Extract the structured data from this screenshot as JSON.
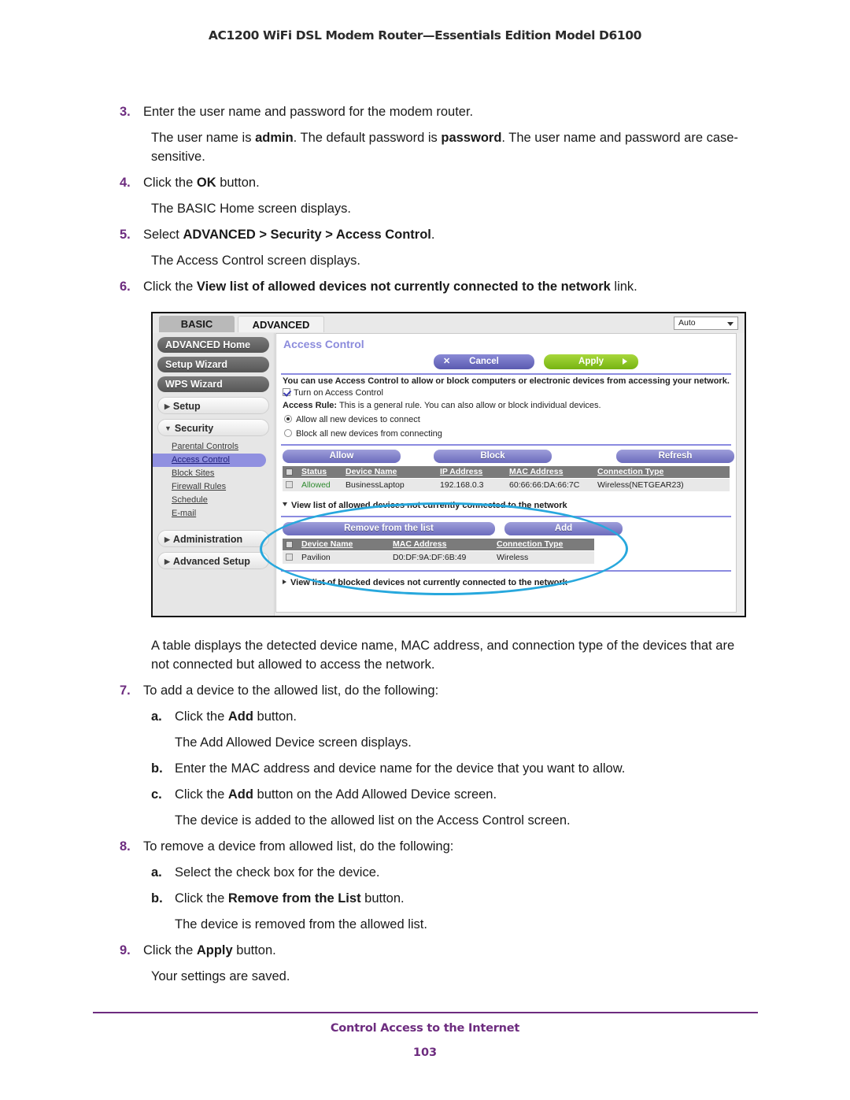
{
  "header": {
    "running_title": "AC1200 WiFi DSL Modem Router—Essentials Edition Model D6100"
  },
  "footer": {
    "section_title": "Control Access to the Internet",
    "page_number": "103"
  },
  "steps": {
    "s3_num": "3.",
    "s3_text": "Enter the user name and password for the modem router.",
    "s3_para_a": "The user name is ",
    "s3_para_admin": "admin",
    "s3_para_b": ". The default password is ",
    "s3_para_password": "password",
    "s3_para_c": ". The user name and password are case-sensitive.",
    "s4_num": "4.",
    "s4_text_a": "Click the ",
    "s4_bold": "OK",
    "s4_text_b": " button.",
    "s4_para": "The BASIC Home screen displays.",
    "s5_num": "5.",
    "s5_text_a": "Select ",
    "s5_bold": "ADVANCED > Security > Access Control",
    "s5_text_b": ".",
    "s5_para": "The Access Control screen displays.",
    "s6_num": "6.",
    "s6_text_a": "Click the ",
    "s6_bold": "View list of allowed devices not currently connected to the network",
    "s6_text_b": " link.",
    "after_shot_para": "A table displays the detected device name, MAC address, and connection type of the devices that are not connected but allowed to access the network.",
    "s7_num": "7.",
    "s7_text": "To add a device to the allowed list, do the following:",
    "s7a_num": "a.",
    "s7a_text_a": "Click the ",
    "s7a_bold": "Add",
    "s7a_text_b": " button.",
    "s7a_para": "The Add Allowed Device screen displays.",
    "s7b_num": "b.",
    "s7b_text": "Enter the MAC address and device name for the device that you want to allow.",
    "s7c_num": "c.",
    "s7c_text_a": "Click the ",
    "s7c_bold": "Add",
    "s7c_text_b": " button on the Add Allowed Device screen.",
    "s7c_para": "The device is added to the allowed list on the Access Control screen.",
    "s8_num": "8.",
    "s8_text": "To remove a device from allowed list, do the following:",
    "s8a_num": "a.",
    "s8a_text": "Select the check box for the device.",
    "s8b_num": "b.",
    "s8b_text_a": "Click the ",
    "s8b_bold": "Remove from the List",
    "s8b_text_b": " button.",
    "s8b_para": "The device is removed from the allowed list.",
    "s9_num": "9.",
    "s9_text_a": "Click the ",
    "s9_bold": "Apply",
    "s9_text_b": " button.",
    "s9_para": "Your settings are saved."
  },
  "screenshot": {
    "tabs": {
      "basic": "BASIC",
      "advanced": "ADVANCED"
    },
    "language_select": {
      "value": "Auto"
    },
    "sidebar": {
      "buttons": [
        "ADVANCED Home",
        "Setup Wizard",
        "WPS Wizard"
      ],
      "sections": [
        {
          "label": "Setup",
          "expanded": false
        },
        {
          "label": "Security",
          "expanded": true
        }
      ],
      "security_items": [
        "Parental Controls",
        "Access Control",
        "Block Sites",
        "Firewall Rules",
        "Schedule",
        "E-mail"
      ],
      "selected_item": "Access Control",
      "bottom_sections": [
        "Administration",
        "Advanced Setup"
      ]
    },
    "pane": {
      "title": "Access Control",
      "cancel_label": "Cancel",
      "apply_label": "Apply",
      "description": "You can use Access Control to allow or block computers or electronic devices from accessing your network.",
      "turn_on_label": "Turn on Access Control",
      "turn_on_checked": true,
      "access_rule_label": "Access Rule:",
      "access_rule_text": " This is a general rule. You can also allow or block individual devices.",
      "radio_allow": "Allow all new devices to connect",
      "radio_block": "Block all new devices from connecting",
      "radio_selected": "allow",
      "buttons": {
        "allow": "Allow",
        "block": "Block",
        "refresh": "Refresh",
        "remove_from_list": "Remove from the list",
        "add": "Add"
      },
      "connected_table": {
        "headers": [
          "Status",
          "Device Name",
          "IP Address",
          "MAC Address",
          "Connection Type"
        ],
        "rows": [
          {
            "status": "Allowed",
            "device_name": "BusinessLaptop",
            "ip_address": "192.168.0.3",
            "mac_address": "60:66:66:DA:66:7C",
            "connection_type": "Wireless(NETGEAR23)"
          }
        ]
      },
      "allowed_link": "View list of allowed devices not currently connected to the network",
      "allowed_table": {
        "headers": [
          "Device Name",
          "MAC Address",
          "Connection Type"
        ],
        "rows": [
          {
            "device_name": "Pavilion",
            "mac_address": "D0:DF:9A:DF:6B:49",
            "connection_type": "Wireless"
          }
        ]
      },
      "blocked_link": "View list of blocked devices not currently connected to the network"
    }
  }
}
